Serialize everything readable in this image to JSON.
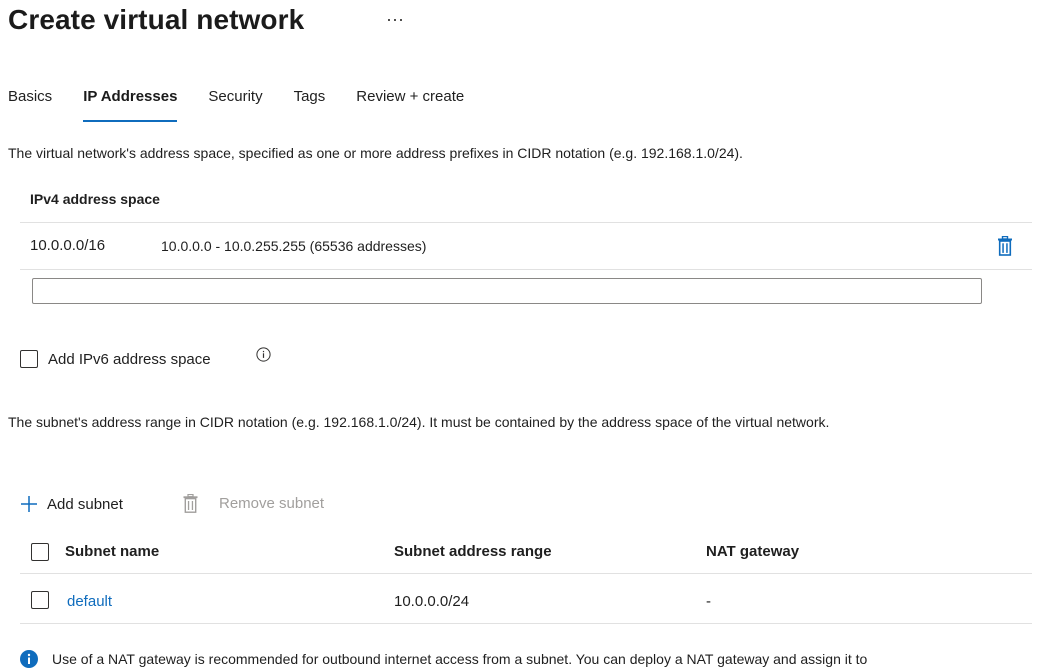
{
  "header": {
    "title": "Create virtual network",
    "more_label": "···"
  },
  "tabs": [
    {
      "label": "Basics",
      "active": false
    },
    {
      "label": "IP Addresses",
      "active": true
    },
    {
      "label": "Security",
      "active": false
    },
    {
      "label": "Tags",
      "active": false
    },
    {
      "label": "Review + create",
      "active": false
    }
  ],
  "address_space": {
    "description": "The virtual network's address space, specified as one or more address prefixes in CIDR notation (e.g. 192.168.1.0/24).",
    "header": "IPv4 address space",
    "rows": [
      {
        "cidr": "10.0.0.0/16",
        "range": "10.0.0.0 - 10.0.255.255 (65536 addresses)"
      }
    ],
    "new_value": "",
    "delete_icon": "trash-icon"
  },
  "ipv6": {
    "label": "Add IPv6 address space",
    "checked": false,
    "info_icon": "info-icon"
  },
  "subnets": {
    "description": "The subnet's address range in CIDR notation (e.g. 192.168.1.0/24). It must be contained by the address space of the virtual network.",
    "add_label": "Add subnet",
    "remove_label": "Remove subnet",
    "columns": [
      "Subnet name",
      "Subnet address range",
      "NAT gateway"
    ],
    "rows": [
      {
        "name": "default",
        "range": "10.0.0.0/24",
        "nat": "-"
      }
    ]
  },
  "info_note": {
    "text": "Use of a NAT gateway is recommended for outbound internet access from a subnet. You can deploy a NAT gateway and assign it to",
    "icon": "info-filled-icon"
  },
  "colors": {
    "accent": "#0f6cbd",
    "disabled": "#a19f9d",
    "divider": "#e1e1e1"
  }
}
